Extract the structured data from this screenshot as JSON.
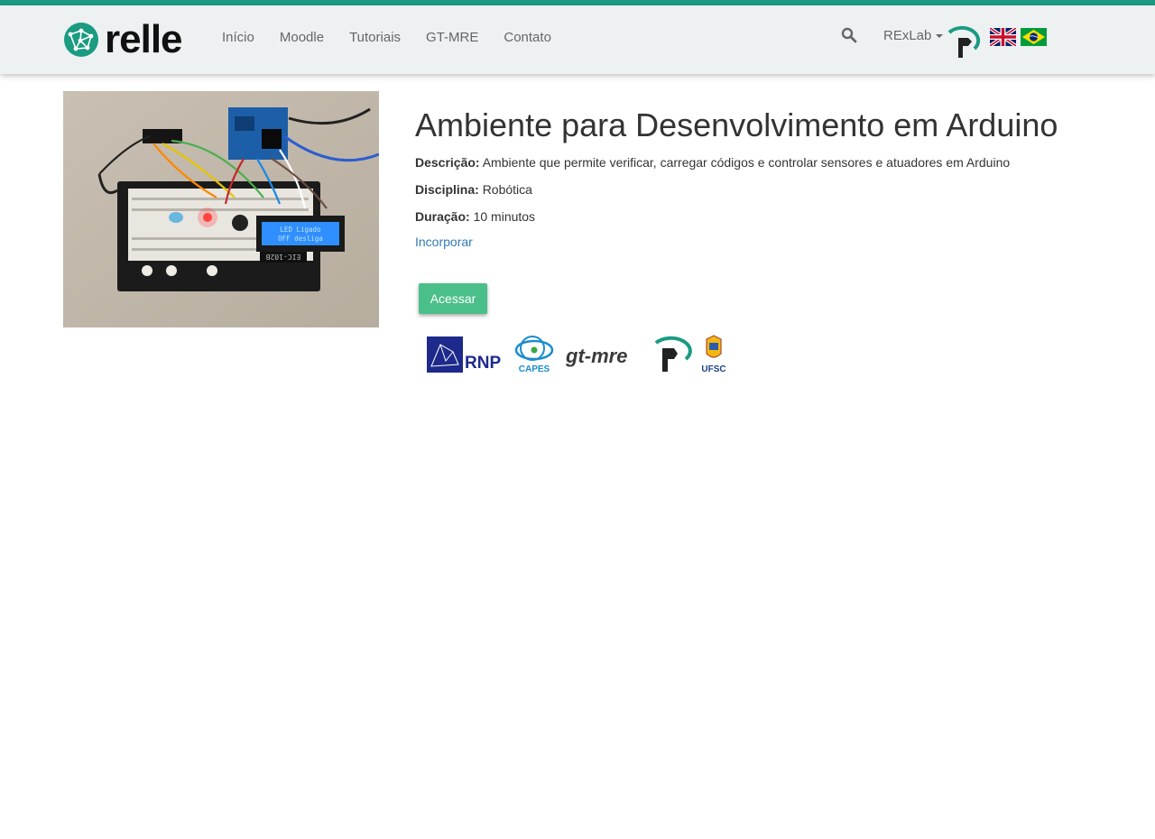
{
  "navbar": {
    "brand": "relle",
    "links": [
      "Início",
      "Moodle",
      "Tutoriais",
      "GT-MRE",
      "Contato"
    ],
    "user_menu": "RExLab",
    "icons": [
      "search-icon",
      "rexlab-logo-icon",
      "uk-flag-icon",
      "brazil-flag-icon"
    ]
  },
  "lab": {
    "title": "Ambiente para Desenvolvimento em Arduino",
    "description_label": "Descrição:",
    "description": "Ambiente que permite verificar, carregar códigos e controlar sensores e atuadores em Arduino",
    "discipline_label": "Disciplina:",
    "discipline": "Robótica",
    "duration_label": "Duração:",
    "duration": "10 minutos",
    "embed_link": "Incorporar",
    "access_button": "Acessar",
    "photo_lcd_line1": "LED Ligado",
    "photo_lcd_line2": "OFF desliga",
    "photo_board_label": "EIC-102B"
  },
  "partners": [
    "RNP",
    "CAPES",
    "gt-mre",
    "UFSC"
  ],
  "colors": {
    "accent": "#1a9b82",
    "navbar_bg": "#eef1f2",
    "button": "#4bbf8a",
    "link": "#337ab7"
  }
}
